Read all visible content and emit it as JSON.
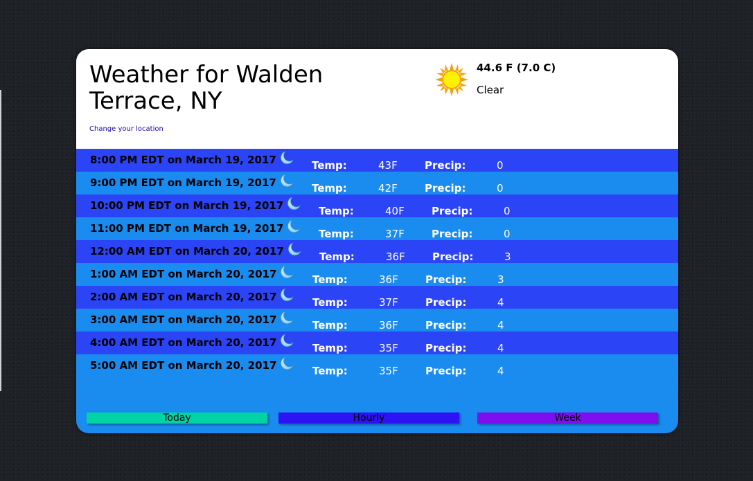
{
  "header": {
    "title": "Weather for Walden Terrace, NY",
    "change_location": "Change your location"
  },
  "current": {
    "temp": "44.6 F (7.0 C)",
    "condition": "Clear",
    "icon": "sun-icon"
  },
  "labels": {
    "temp": "Temp:",
    "precip": "Precip:"
  },
  "hourly": [
    {
      "time": "8:00 PM EDT on March 19, 2017",
      "temp": "43F",
      "precip": "0",
      "icon": "moon-icon"
    },
    {
      "time": "9:00 PM EDT on March 19, 2017",
      "temp": "42F",
      "precip": "0",
      "icon": "moon-icon"
    },
    {
      "time": "10:00 PM EDT on March 19, 2017",
      "temp": "40F",
      "precip": "0",
      "icon": "moon-icon"
    },
    {
      "time": "11:00 PM EDT on March 19, 2017",
      "temp": "37F",
      "precip": "0",
      "icon": "moon-icon"
    },
    {
      "time": "12:00 AM EDT on March 20, 2017",
      "temp": "36F",
      "precip": "3",
      "icon": "moon-icon"
    },
    {
      "time": "1:00 AM EDT on March 20, 2017",
      "temp": "36F",
      "precip": "3",
      "icon": "moon-icon"
    },
    {
      "time": "2:00 AM EDT on March 20, 2017",
      "temp": "37F",
      "precip": "4",
      "icon": "moon-icon"
    },
    {
      "time": "3:00 AM EDT on March 20, 2017",
      "temp": "36F",
      "precip": "4",
      "icon": "moon-icon"
    },
    {
      "time": "4:00 AM EDT on March 20, 2017",
      "temp": "35F",
      "precip": "4",
      "icon": "moon-icon"
    },
    {
      "time": "5:00 AM EDT on March 20, 2017",
      "temp": "35F",
      "precip": "4",
      "icon": "moon-icon"
    }
  ],
  "tabs": {
    "today": "Today",
    "hourly": "Hourly",
    "week": "Week"
  },
  "colors": {
    "row_dark": "#2b44f5",
    "row_light": "#1a8cf0",
    "tab_today": "#00d4a4",
    "tab_hourly": "#2d12f5",
    "tab_week": "#7d0ef0"
  }
}
